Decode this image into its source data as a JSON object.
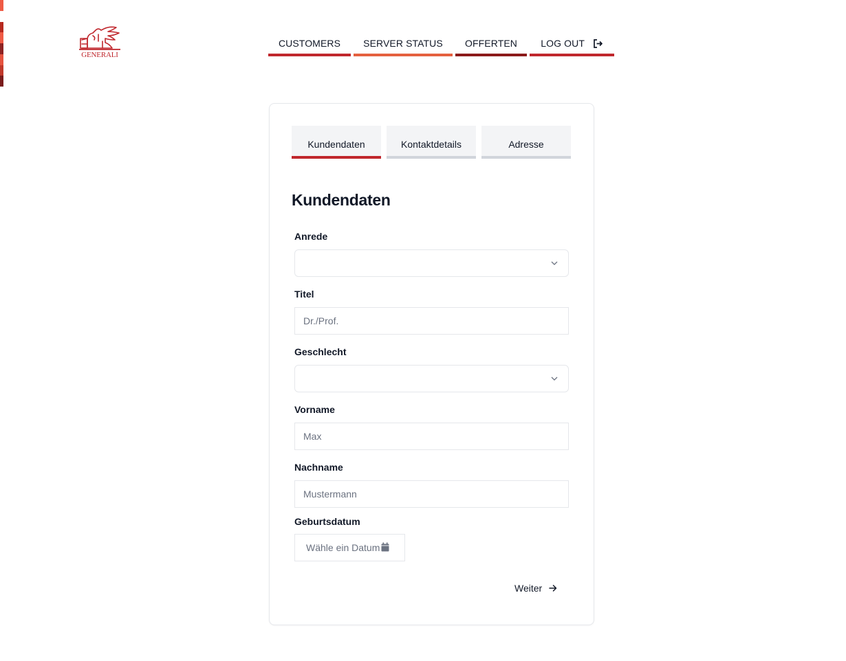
{
  "brand": {
    "logo_text": "GENERALI",
    "accent_color": "#c0272d",
    "edge_stripe_colors": [
      "#e74c3c",
      "#c0392b",
      "#a93226",
      "#e74c3c",
      "#8e2323",
      "#c0392b",
      "#e5533f",
      "#9b2226"
    ]
  },
  "nav": {
    "items": [
      {
        "label": "CUSTOMERS",
        "bar_color": "#c0272d"
      },
      {
        "label": "SERVER STATUS",
        "bar_color": "#e5603f"
      },
      {
        "label": "OFFERTEN",
        "bar_color": "#8b1a1a"
      },
      {
        "label": "LOG OUT",
        "bar_color": "#c0272d",
        "icon": "logout-icon"
      }
    ]
  },
  "tabs": [
    {
      "label": "Kundendaten",
      "active": true
    },
    {
      "label": "Kontaktdetails",
      "active": false
    },
    {
      "label": "Adresse",
      "active": false
    }
  ],
  "form": {
    "title": "Kundendaten",
    "anrede": {
      "label": "Anrede",
      "value": ""
    },
    "titel": {
      "label": "Titel",
      "placeholder": "Dr./Prof."
    },
    "geschlecht": {
      "label": "Geschlecht",
      "value": ""
    },
    "vorname": {
      "label": "Vorname",
      "placeholder": "Max"
    },
    "nachname": {
      "label": "Nachname",
      "placeholder": "Mustermann"
    },
    "geburtsdatum": {
      "label": "Geburtsdatum",
      "placeholder": "Wähle ein Datum",
      "icon": "calendar-icon"
    },
    "next_label": "Weiter"
  }
}
